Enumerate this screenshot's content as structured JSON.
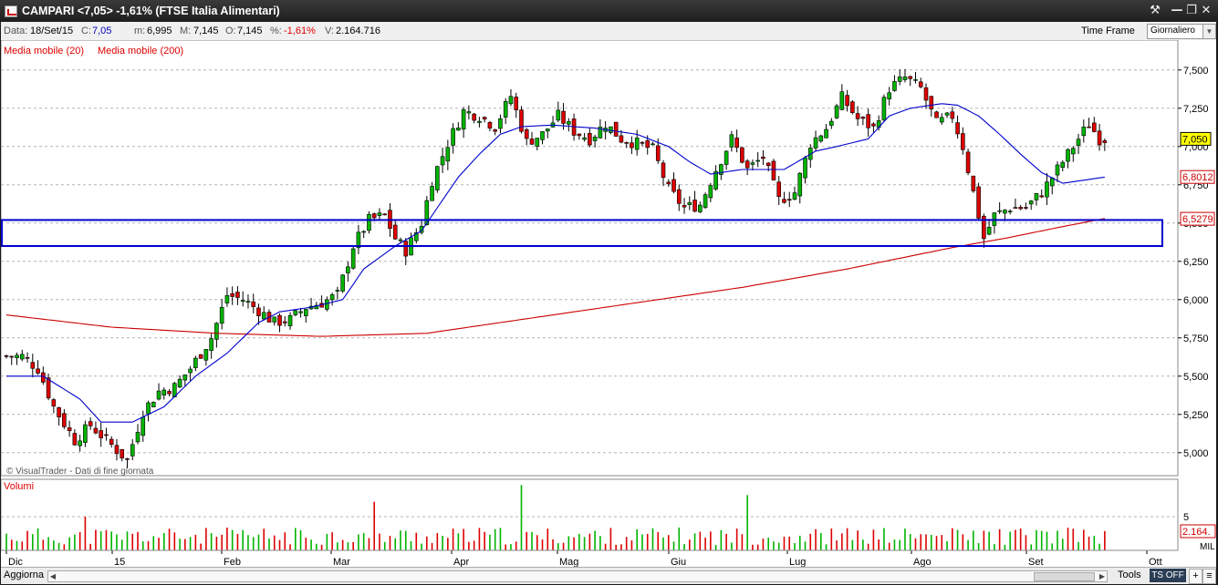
{
  "window": {
    "title": "CAMPARI <7,05> -1,61%  (FTSE Italia Alimentari)",
    "buttons": [
      "⚒",
      "—",
      "❐",
      "✕"
    ]
  },
  "info": {
    "data_label": "Data:",
    "data_value": "18/Set/15",
    "c_label": "C:",
    "c_value": "7,05",
    "m_label": "m:",
    "m_value": "6,995",
    "M_label": "M:",
    "M_value": "7,145",
    "o_label": "O:",
    "o_value": "7,145",
    "pct_label": "%:",
    "pct_value": "-1,61%",
    "v_label": "V:",
    "v_value": "2.164.716",
    "time_frame_label": "Time Frame",
    "time_frame_value": "Giornaliero"
  },
  "bottom": {
    "refresh_label": "Aggiorna",
    "tools_label": "Tools",
    "tsoff_label": "TS OFF",
    "plus_label": "+",
    "menu_label": "≡"
  },
  "colors": {
    "up": "#00b400",
    "down": "#dd0000",
    "ma20": "#0000cc",
    "ma200": "#cc0000",
    "channel": "#0000cc"
  },
  "chart_data": [
    {
      "type": "candlestick",
      "title": "",
      "indicators": [
        {
          "name": "Media mobile (20)",
          "color": "#dd0000"
        },
        {
          "name": "Media mobile (200)",
          "color": "#dd0000"
        }
      ],
      "copyright": "© VisualTrader - Dati di fine giornata",
      "y_ticks": [
        "7,500",
        "7,250",
        "7,000",
        "6,750",
        "6,500",
        "6,250",
        "6,000",
        "5,750",
        "5,500",
        "5,250",
        "5,000"
      ],
      "ylim": [
        4.85,
        7.6
      ],
      "x_ticks": [
        "Dic",
        "15",
        "Feb",
        "Mar",
        "Apr",
        "Mag",
        "Giu",
        "Lug",
        "Ago",
        "Set",
        "Ott"
      ],
      "price_tags": [
        {
          "label": "7,050",
          "value": 7.05,
          "style": "current"
        },
        {
          "label": "6,8012",
          "value": 6.8012,
          "style": "ma"
        },
        {
          "label": "6,5279",
          "value": 6.5279,
          "style": "ma"
        }
      ],
      "channel": {
        "upper": 6.52,
        "lower": 6.35
      },
      "anchors": [
        [
          0,
          5.63
        ],
        [
          4,
          5.63
        ],
        [
          7,
          5.55
        ],
        [
          10,
          5.3
        ],
        [
          14,
          5.08
        ],
        [
          17,
          5.18
        ],
        [
          21,
          5.05
        ],
        [
          24,
          4.95
        ],
        [
          27,
          5.27
        ],
        [
          30,
          5.4
        ],
        [
          33,
          5.43
        ],
        [
          36,
          5.55
        ],
        [
          40,
          5.75
        ],
        [
          43,
          6.03
        ],
        [
          46,
          6.0
        ],
        [
          49,
          5.93
        ],
        [
          52,
          5.85
        ],
        [
          55,
          5.87
        ],
        [
          58,
          5.95
        ],
        [
          61,
          5.98
        ],
        [
          64,
          6.03
        ],
        [
          67,
          6.35
        ],
        [
          70,
          6.52
        ],
        [
          73,
          6.55
        ],
        [
          75,
          6.4
        ],
        [
          77,
          6.32
        ],
        [
          80,
          6.5
        ],
        [
          82,
          6.78
        ],
        [
          85,
          7.02
        ],
        [
          88,
          7.23
        ],
        [
          91,
          7.2
        ],
        [
          94,
          7.13
        ],
        [
          97,
          7.33
        ],
        [
          100,
          7.03
        ],
        [
          103,
          7.08
        ],
        [
          106,
          7.2
        ],
        [
          109,
          7.1
        ],
        [
          112,
          7.05
        ],
        [
          115,
          7.15
        ],
        [
          118,
          7.05
        ],
        [
          121,
          7.02
        ],
        [
          124,
          6.98
        ],
        [
          127,
          6.72
        ],
        [
          130,
          6.6
        ],
        [
          133,
          6.62
        ],
        [
          136,
          6.85
        ],
        [
          139,
          7.05
        ],
        [
          142,
          6.85
        ],
        [
          145,
          6.93
        ],
        [
          148,
          6.65
        ],
        [
          151,
          6.7
        ],
        [
          154,
          7.02
        ],
        [
          157,
          7.12
        ],
        [
          160,
          7.32
        ],
        [
          163,
          7.18
        ],
        [
          166,
          7.12
        ],
        [
          169,
          7.38
        ],
        [
          172,
          7.45
        ],
        [
          175,
          7.38
        ],
        [
          178,
          7.15
        ],
        [
          181,
          7.2
        ],
        [
          183,
          7.0
        ],
        [
          185,
          6.7
        ],
        [
          187,
          6.4
        ],
        [
          189,
          6.55
        ],
        [
          192,
          6.6
        ],
        [
          195,
          6.6
        ],
        [
          198,
          6.7
        ],
        [
          201,
          6.85
        ],
        [
          204,
          7.0
        ],
        [
          207,
          7.15
        ],
        [
          209,
          7.05
        ]
      ],
      "ma20_anchors": [
        [
          0,
          5.5
        ],
        [
          7,
          5.5
        ],
        [
          14,
          5.35
        ],
        [
          18,
          5.2
        ],
        [
          24,
          5.2
        ],
        [
          30,
          5.3
        ],
        [
          36,
          5.5
        ],
        [
          42,
          5.65
        ],
        [
          48,
          5.85
        ],
        [
          52,
          5.92
        ],
        [
          58,
          5.95
        ],
        [
          64,
          6.0
        ],
        [
          68,
          6.2
        ],
        [
          74,
          6.35
        ],
        [
          79,
          6.45
        ],
        [
          82,
          6.6
        ],
        [
          86,
          6.8
        ],
        [
          90,
          6.95
        ],
        [
          94,
          7.08
        ],
        [
          98,
          7.13
        ],
        [
          104,
          7.14
        ],
        [
          112,
          7.12
        ],
        [
          120,
          7.08
        ],
        [
          126,
          7.0
        ],
        [
          130,
          6.9
        ],
        [
          134,
          6.82
        ],
        [
          140,
          6.85
        ],
        [
          148,
          6.85
        ],
        [
          154,
          6.97
        ],
        [
          158,
          7.0
        ],
        [
          164,
          7.05
        ],
        [
          168,
          7.2
        ],
        [
          172,
          7.25
        ],
        [
          178,
          7.28
        ],
        [
          181,
          7.27
        ],
        [
          185,
          7.2
        ],
        [
          189,
          7.08
        ],
        [
          193,
          6.95
        ],
        [
          197,
          6.83
        ],
        [
          201,
          6.76
        ],
        [
          205,
          6.78
        ],
        [
          209,
          6.8
        ]
      ],
      "ma200_anchors": [
        [
          0,
          5.9
        ],
        [
          20,
          5.82
        ],
        [
          40,
          5.78
        ],
        [
          60,
          5.76
        ],
        [
          80,
          5.78
        ],
        [
          100,
          5.88
        ],
        [
          120,
          5.98
        ],
        [
          140,
          6.08
        ],
        [
          160,
          6.2
        ],
        [
          170,
          6.27
        ],
        [
          180,
          6.34
        ],
        [
          190,
          6.4
        ],
        [
          200,
          6.47
        ],
        [
          209,
          6.53
        ]
      ]
    },
    {
      "type": "bar",
      "title": "Volumi",
      "y_ticks": [
        "5"
      ],
      "last_value_tag": "2.164.",
      "unit_tag": "MIL",
      "ylim": [
        0,
        10
      ]
    }
  ]
}
